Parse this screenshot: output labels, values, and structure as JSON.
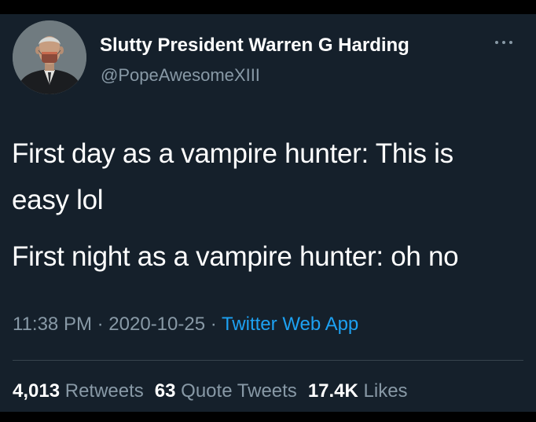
{
  "user": {
    "display_name": "Slutty President Warren G Harding",
    "handle": "@PopeAwesomeXIII",
    "avatar_icon": "profile-photo"
  },
  "tweet": {
    "lines": [
      "First day as a vampire hunter: This is",
      "easy lol",
      "First night as a vampire hunter: oh no"
    ],
    "time": "11:38 PM",
    "date": "2020-10-25",
    "separator": "·",
    "source": "Twitter Web App"
  },
  "stats": {
    "retweets_count": "4,013",
    "retweets_label": "Retweets",
    "quote_count": "63",
    "quote_label": "Quote Tweets",
    "likes_count": "17.4K",
    "likes_label": "Likes"
  },
  "menu_icon": "more-icon",
  "colors": {
    "background": "#15202b",
    "text": "#ffffff",
    "secondary": "#8899a6",
    "link": "#1da1f2",
    "divider": "#38444d"
  }
}
